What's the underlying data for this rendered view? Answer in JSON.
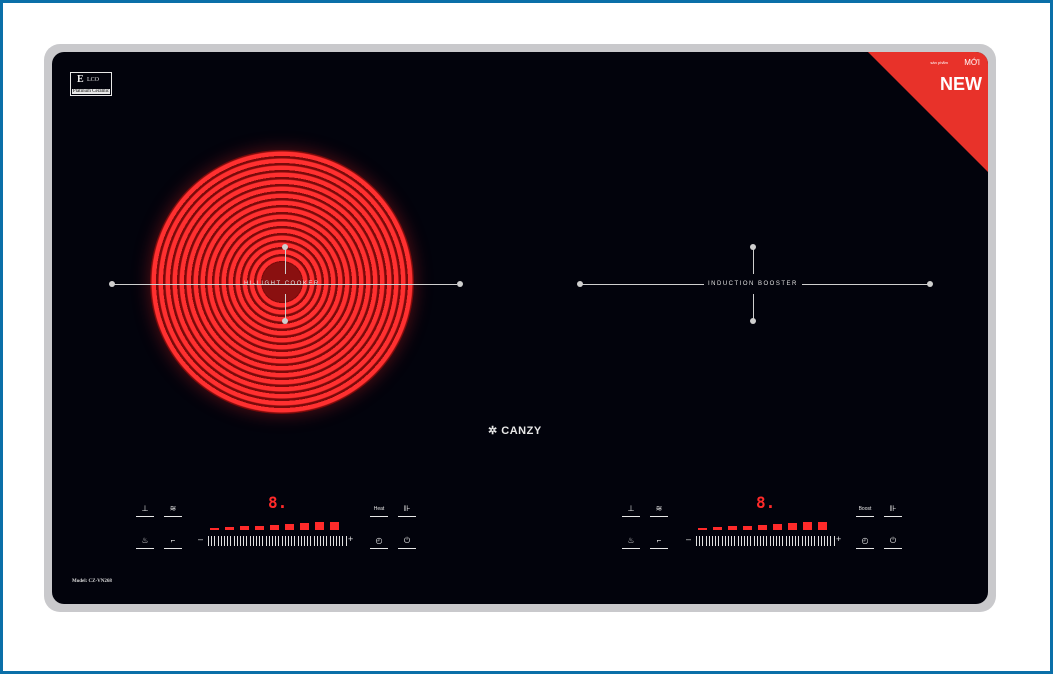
{
  "eco_badge": {
    "top": "E",
    "sub": "LCO",
    "bottom": "Platinum Ceramic"
  },
  "zone_left_label": "HI-LIGHT COOKER",
  "zone_right_label": "INDUCTION BOOSTER",
  "brand": "CANZY",
  "model": "Model: CZ-VN268",
  "new_ribbon": {
    "new": "NEW",
    "moi": "MỚI",
    "small": "sản phẩm"
  },
  "left_panel": {
    "display": "8.",
    "mode_label": "Heat",
    "level_bars": 9
  },
  "right_panel": {
    "display": "8.",
    "mode_label": "Boost",
    "level_bars": 9
  },
  "colors": {
    "accent_red": "#ff2a2a",
    "glass": "#02030c",
    "frame_blue": "#0b6fa8"
  }
}
